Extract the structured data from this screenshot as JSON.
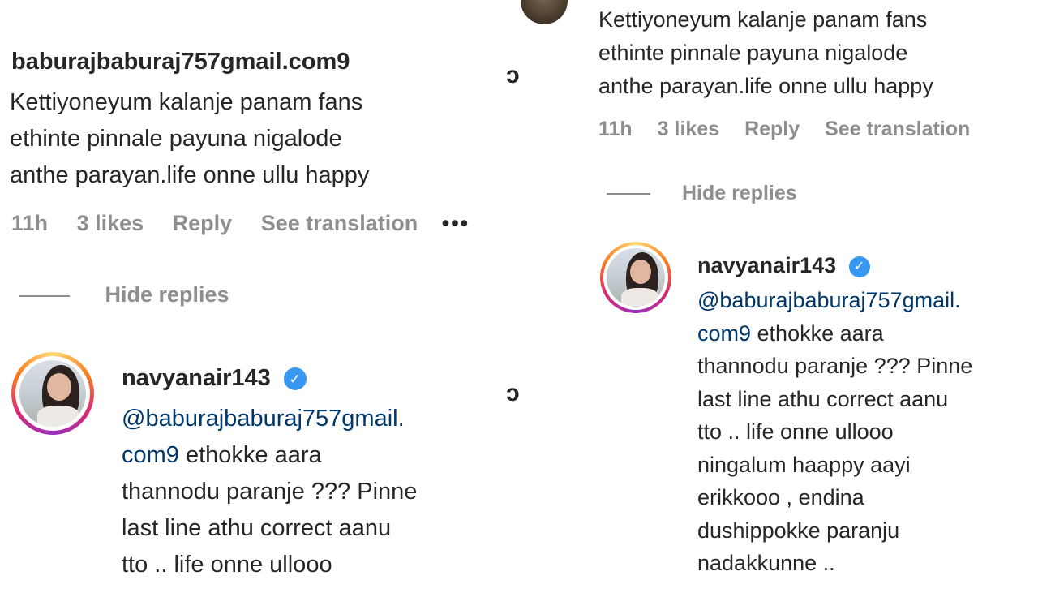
{
  "comment": {
    "username": "baburajbaburaj757gmail.com9",
    "text_lines": [
      "Kettiyoneyum kalanje panam fans",
      "ethinte pinnale payuna nigalode",
      "anthe parayan.life onne ullu happy"
    ],
    "time": "11h",
    "likes": "3 likes",
    "reply_label": "Reply",
    "translation_label": "See translation",
    "more_label": "•••"
  },
  "hide_replies_label": "Hide replies",
  "reply": {
    "username": "navyanair143",
    "verified_icon": "verified-badge-icon",
    "mention": "@baburajbaburaj757gmail.",
    "mention_cont": "com9",
    "left_lines": [
      " ethokke aara",
      "thannodu paranje ??? Pinne",
      "last line athu correct aanu",
      "tto .. life onne ullooo"
    ],
    "right_lines": [
      " ethokke aara",
      "thannodu paranje ??? Pinne",
      "last line athu correct aanu",
      "tto .. life onne ullooo",
      "ningalum haappy aayi",
      "erikkooo , endina",
      "dushippokke paranju",
      "nadakkunne .."
    ]
  },
  "icons": {
    "like": "heart-icon",
    "verified": "verified-badge-icon"
  },
  "colors": {
    "text": "#262626",
    "meta": "#8e8e8e",
    "mention": "#00376b",
    "verified": "#3897f0"
  }
}
